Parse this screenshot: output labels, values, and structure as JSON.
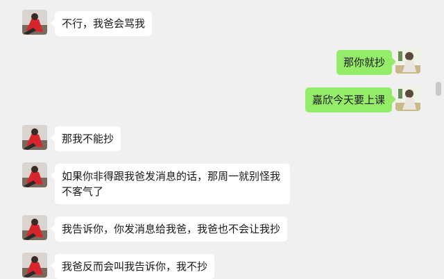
{
  "colors": {
    "background": "#f0f0f0",
    "incoming_bubble": "#ffffff",
    "outgoing_bubble": "#95ec69",
    "text": "#191919",
    "scrollbar": "#c8c8c8"
  },
  "icons": {
    "contact_avatar": "contact-avatar-icon",
    "self_avatar": "self-avatar-icon"
  },
  "messages": [
    {
      "side": "left",
      "text": "不行，我爸会骂我"
    },
    {
      "side": "right",
      "text": "那你就抄"
    },
    {
      "side": "right",
      "text": "嘉欣今天要上课"
    },
    {
      "side": "left",
      "text": "那我不能抄"
    },
    {
      "side": "left",
      "text": "如果你非得跟我爸发消息的话，那周一就别怪我不客气了"
    },
    {
      "side": "left",
      "text": "我告诉你，你发消息给我爸，我爸也不会让我抄"
    },
    {
      "side": "left",
      "text": "我爸反而会叫我告诉你，我不抄"
    }
  ]
}
